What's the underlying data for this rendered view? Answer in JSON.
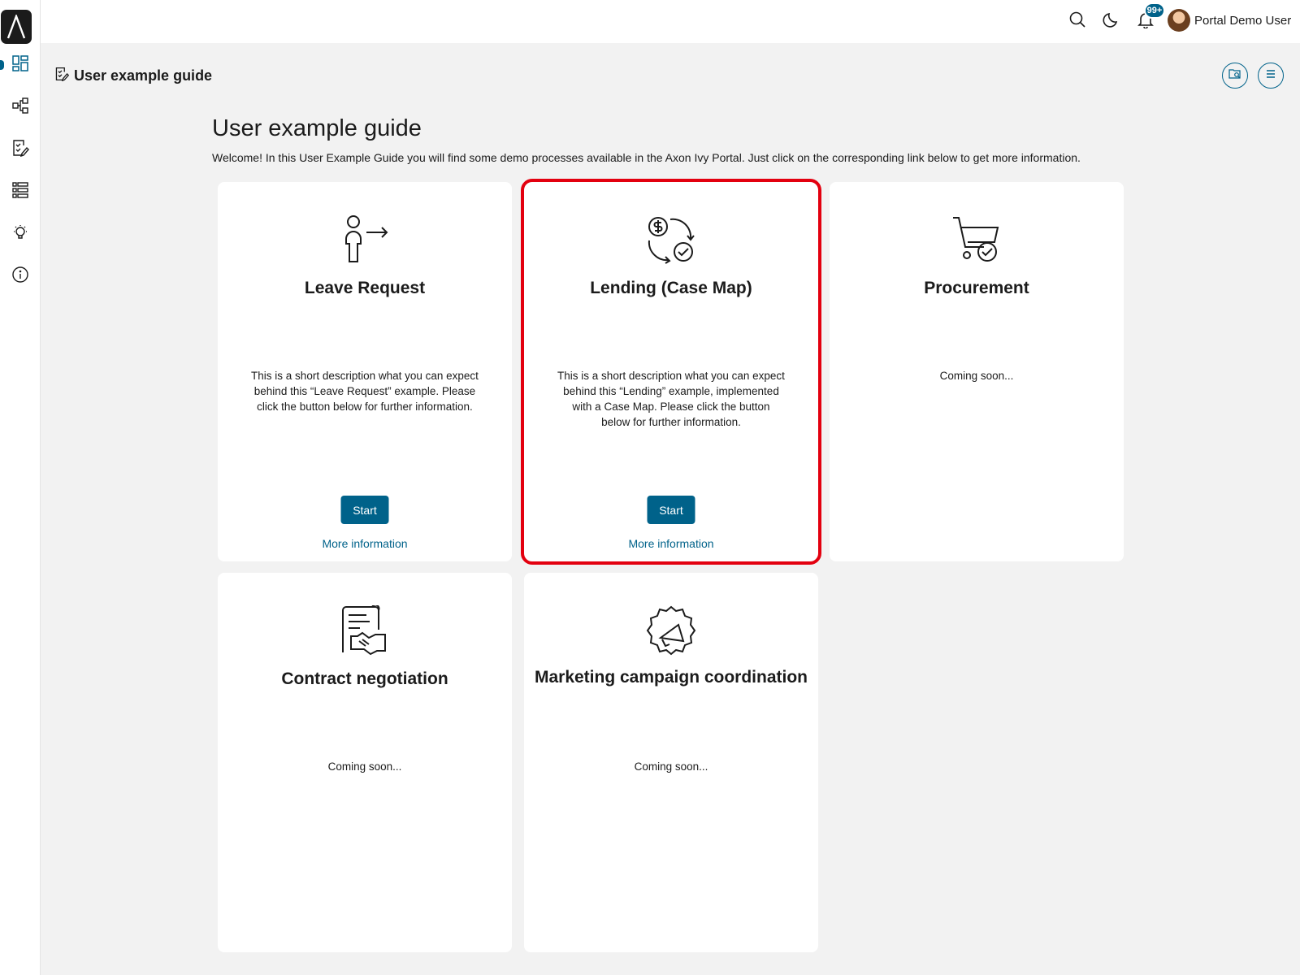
{
  "sidebar": {
    "logo": "axon-ivy-logo",
    "items": [
      {
        "name": "dashboard",
        "icon": "dashboard-icon",
        "active": true
      },
      {
        "name": "processes",
        "icon": "process-icon",
        "active": false
      },
      {
        "name": "tasks",
        "icon": "task-edit-icon",
        "active": false
      },
      {
        "name": "cases",
        "icon": "case-list-icon",
        "active": false
      },
      {
        "name": "statistics",
        "icon": "lightbulb-icon",
        "active": false
      },
      {
        "name": "about",
        "icon": "info-icon",
        "active": false
      }
    ]
  },
  "header": {
    "notification_badge": "99+",
    "user_name": "Portal Demo User",
    "icons": [
      "search-icon",
      "moon-icon",
      "bell-icon"
    ]
  },
  "page": {
    "header_title": "User example guide",
    "title": "User example guide",
    "intro": "Welcome! In this User Example Guide you will find some demo processes available in the Axon Ivy Portal. Just click on the corresponding link below to get more information."
  },
  "cards": [
    {
      "title": "Leave Request",
      "icon": "person-leave-icon",
      "description": "This is a short description what you can expect behind this “Leave Request” example. Please click the button below for further information.",
      "start_label": "Start",
      "more_label": "More information"
    },
    {
      "title": "Lending (Case Map)",
      "icon": "lending-money-icon",
      "description": "This is a short description what you can expect behind this “Lending” example, implemented with a Case Map. Please click the button below for further information.",
      "start_label": "Start",
      "more_label": "More information",
      "highlighted": true
    },
    {
      "title": "Procurement",
      "icon": "shopping-cart-check-icon",
      "description": "Coming soon..."
    },
    {
      "title": "Contract negotiation",
      "icon": "contract-handshake-icon",
      "description": "Coming soon..."
    },
    {
      "title": "Marketing campaign coordination",
      "icon": "megaphone-badge-icon",
      "description": "Coming soon..."
    }
  ],
  "colors": {
    "accent": "#00628a",
    "highlight": "#e3000f",
    "background": "#f2f2f2"
  }
}
